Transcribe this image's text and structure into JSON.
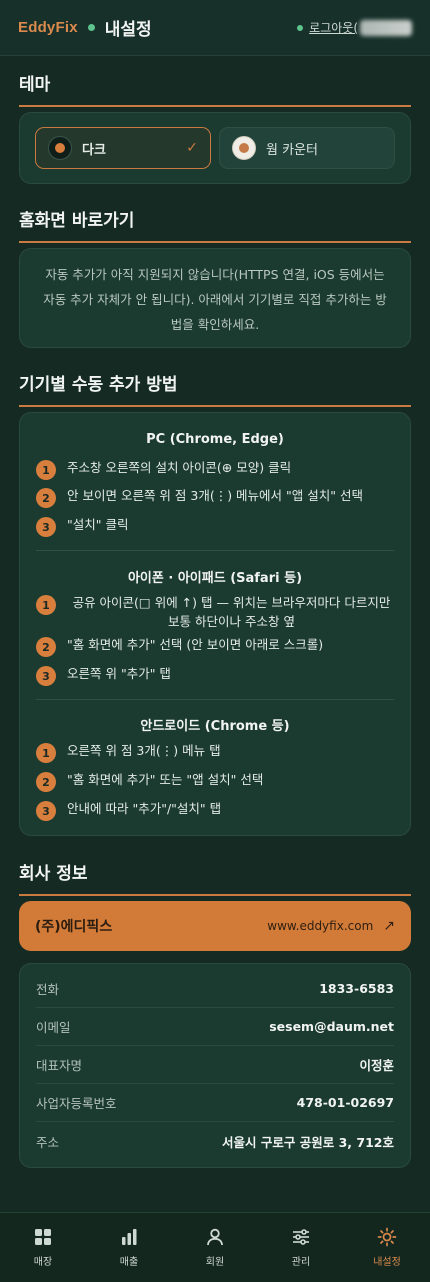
{
  "header": {
    "brand": "EddyFix",
    "title": "내설정",
    "logout_label": "로그아웃("
  },
  "theme": {
    "section_title": "테마",
    "options": [
      {
        "label": "다크",
        "selected": true
      },
      {
        "label": "웜 카운터",
        "selected": false
      }
    ],
    "check_mark": "✓"
  },
  "shortcut": {
    "section_title": "홈화면 바로가기",
    "notice": "자동 추가가 아직 지원되지 않습니다(HTTPS 연결, iOS 등에서는 자동 추가 자체가 안 됩니다). 아래에서 기기별로 직접 추가하는 방법을 확인하세요."
  },
  "manual": {
    "section_title": "기기별 수동 추가 방법",
    "devices": [
      {
        "title": "PC (Chrome, Edge)",
        "steps": [
          "주소창 오른쪽의 설치 아이콘(⊕ 모양) 클릭",
          "안 보이면 오른쪽 위 점 3개(⋮) 메뉴에서 \"앱 설치\" 선택",
          "\"설치\" 클릭"
        ]
      },
      {
        "title": "아이폰 · 아이패드 (Safari 등)",
        "steps": [
          "공유 아이콘(□ 위에 ↑) 탭 — 위치는 브라우저마다 다르지만 보통 하단이나 주소창 옆",
          "\"홈 화면에 추가\" 선택 (안 보이면 아래로 스크롤)",
          "오른쪽 위 \"추가\" 탭"
        ]
      },
      {
        "title": "안드로이드 (Chrome 등)",
        "steps": [
          "오른쪽 위 점 3개(⋮) 메뉴 탭",
          "\"홈 화면에 추가\" 또는 \"앱 설치\" 선택",
          "안내에 따라 \"추가\"/\"설치\" 탭"
        ]
      }
    ],
    "step_numbers": [
      "1",
      "2",
      "3"
    ]
  },
  "company": {
    "section_title": "회사 정보",
    "name": "(주)에디픽스",
    "website": "www.eddyfix.com",
    "link_arrow": "↗",
    "rows": [
      {
        "label": "전화",
        "value": "1833-6583"
      },
      {
        "label": "이메일",
        "value": "sesem@daum.net"
      },
      {
        "label": "대표자명",
        "value": "이정훈"
      },
      {
        "label": "사업자등록번호",
        "value": "478-01-02697"
      },
      {
        "label": "주소",
        "value": "서울시 구로구 공원로 3, 712호"
      }
    ]
  },
  "nav": {
    "items": [
      {
        "label": "매장",
        "icon": "grid-icon",
        "active": false
      },
      {
        "label": "매출",
        "icon": "bar-chart-icon",
        "active": false
      },
      {
        "label": "회원",
        "icon": "user-icon",
        "active": false
      },
      {
        "label": "관리",
        "icon": "sliders-icon",
        "active": false
      },
      {
        "label": "내설정",
        "icon": "sun-gear-icon",
        "active": true
      }
    ]
  },
  "colors": {
    "accent": "#d27a37",
    "background": "#142a23",
    "card": "#1b3a30",
    "status_dot": "#5fc38e"
  }
}
